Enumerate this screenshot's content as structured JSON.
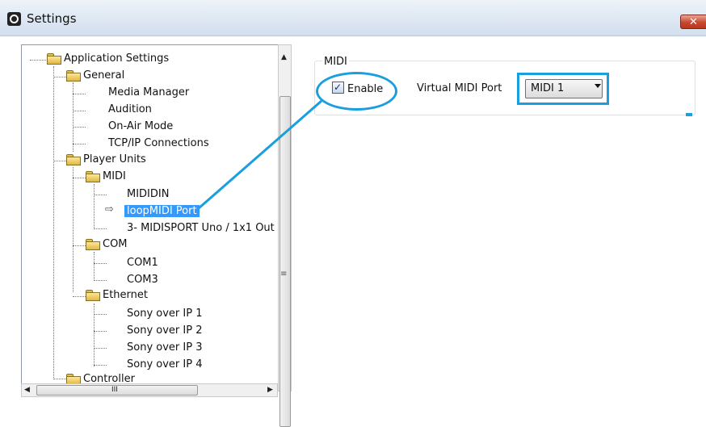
{
  "window": {
    "title": "Settings",
    "close_label": "✕"
  },
  "tree": {
    "items": [
      {
        "label": "Application Settings"
      },
      {
        "label": "General"
      },
      {
        "label": "Media Manager"
      },
      {
        "label": "Audition"
      },
      {
        "label": "On-Air Mode"
      },
      {
        "label": "TCP/IP Connections"
      },
      {
        "label": "Player Units"
      },
      {
        "label": "MIDI"
      },
      {
        "label": "MIDIDIN"
      },
      {
        "label": "loopMIDI Port"
      },
      {
        "label": "3- MIDISPORT Uno / 1x1 Out"
      },
      {
        "label": "COM"
      },
      {
        "label": "COM1"
      },
      {
        "label": "COM3"
      },
      {
        "label": "Ethernet"
      },
      {
        "label": "Sony over IP 1"
      },
      {
        "label": "Sony over IP 2"
      },
      {
        "label": "Sony over IP 3"
      },
      {
        "label": "Sony over IP 4"
      },
      {
        "label": "Controller"
      }
    ],
    "selected": "loopMIDI Port"
  },
  "scrollbars": {
    "up": "▲",
    "down": "▼",
    "left": "◀",
    "right": "▶",
    "v_grip": "≡",
    "h_grip": "III"
  },
  "midi_group": {
    "title": "MIDI",
    "enable_label": "Enable",
    "enable_checked": true,
    "port_label": "Virtual MIDI Port",
    "port_value": "MIDI 1"
  },
  "colors": {
    "annotation": "#1a9fde",
    "selection": "#3399ff"
  }
}
